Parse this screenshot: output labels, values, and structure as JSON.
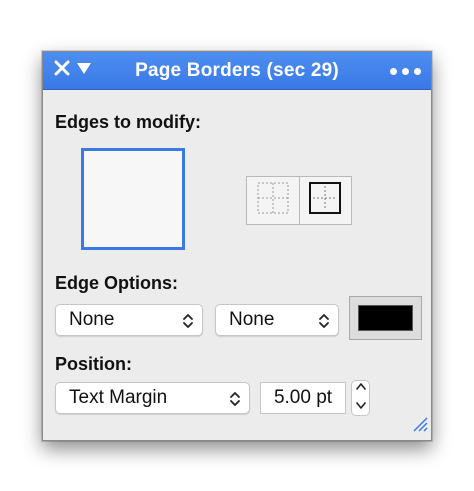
{
  "window": {
    "title": "Page Borders (sec 29)",
    "accent_color": "#3a79e6"
  },
  "edges": {
    "label": "Edges to modify:",
    "segment_icons": [
      "all-edges-dotted-grid-icon",
      "outer-box-icon"
    ]
  },
  "edge_options": {
    "label": "Edge Options:",
    "style_value": "None",
    "width_value": "None",
    "color": "#000000"
  },
  "position": {
    "label": "Position:",
    "relative_to": "Text Margin",
    "offset_value": "5.00 pt"
  }
}
